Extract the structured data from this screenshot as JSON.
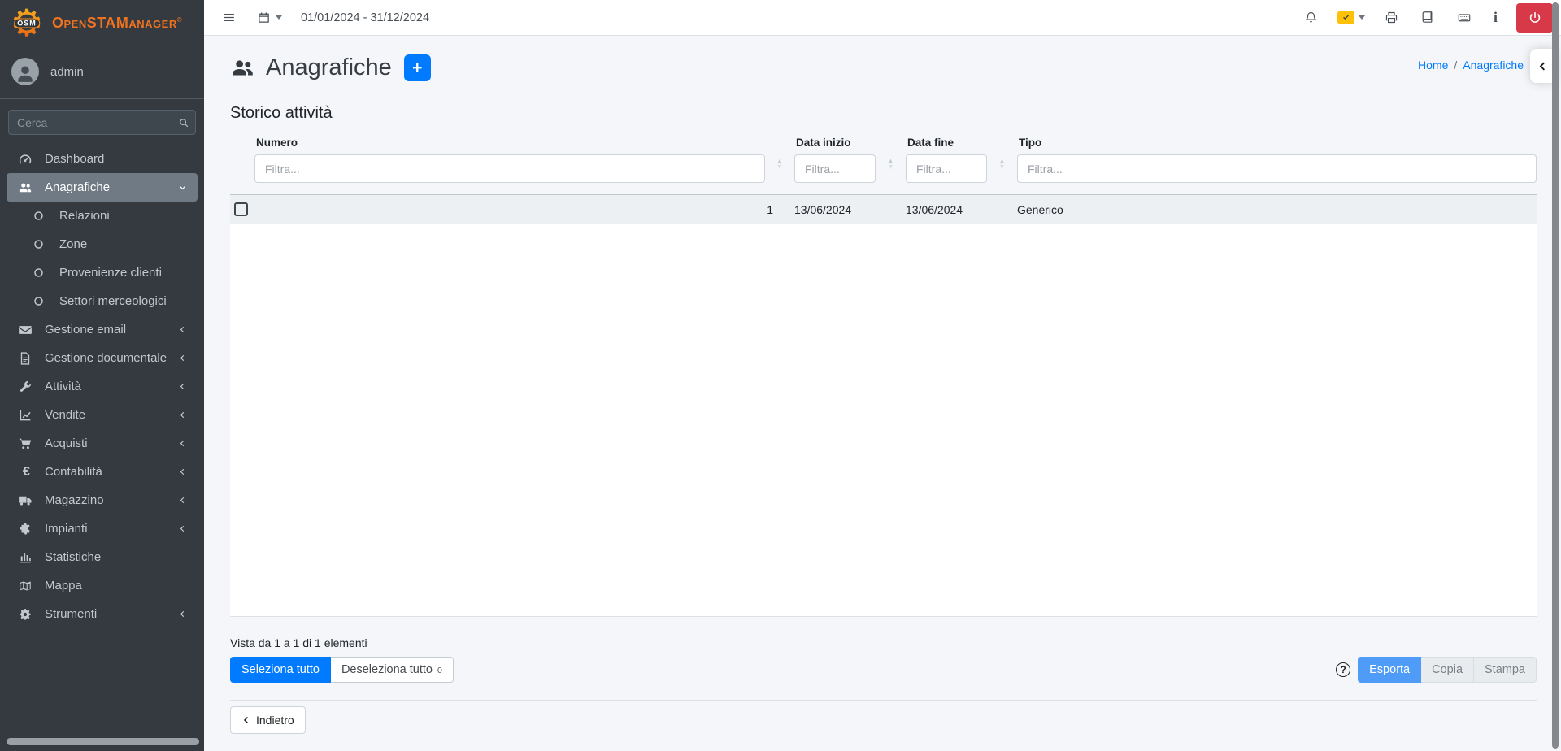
{
  "branding": {
    "logo_text": "OSM",
    "app_name": "OpenSTAManager",
    "registered": "®"
  },
  "user": {
    "name": "admin"
  },
  "topbar": {
    "date_range": "01/01/2024 - 31/12/2024",
    "icons": [
      "hamburger-icon",
      "calendar-icon",
      "bell-icon",
      "status-check-badge",
      "printer-icon",
      "book-icon",
      "keyboard-icon",
      "info-icon",
      "power-icon"
    ]
  },
  "sidebar": {
    "search_placeholder": "Cerca",
    "items": [
      {
        "label": "Dashboard",
        "icon": "tachometer-icon"
      },
      {
        "label": "Anagrafiche",
        "icon": "users-icon",
        "active": true,
        "expanded": true
      },
      {
        "label": "Relazioni",
        "icon": "circle-o-icon",
        "child": true
      },
      {
        "label": "Zone",
        "icon": "circle-o-icon",
        "child": true
      },
      {
        "label": "Provenienze clienti",
        "icon": "circle-o-icon",
        "child": true
      },
      {
        "label": "Settori merceologici",
        "icon": "circle-o-icon",
        "child": true
      },
      {
        "label": "Gestione email",
        "icon": "envelope-icon",
        "has_children": true
      },
      {
        "label": "Gestione documentale",
        "icon": "file-icon",
        "has_children": true
      },
      {
        "label": "Attività",
        "icon": "wrench-icon",
        "has_children": true
      },
      {
        "label": "Vendite",
        "icon": "chart-line-icon",
        "has_children": true
      },
      {
        "label": "Acquisti",
        "icon": "cart-icon",
        "has_children": true
      },
      {
        "label": "Contabilità",
        "icon": "euro-icon",
        "has_children": true
      },
      {
        "label": "Magazzino",
        "icon": "truck-icon",
        "has_children": true
      },
      {
        "label": "Impianti",
        "icon": "puzzle-icon",
        "has_children": true
      },
      {
        "label": "Statistiche",
        "icon": "chart-bar-icon"
      },
      {
        "label": "Mappa",
        "icon": "map-icon"
      },
      {
        "label": "Strumenti",
        "icon": "gear-icon",
        "has_children": true
      }
    ]
  },
  "page": {
    "title": "Anagrafiche",
    "add_label": "+",
    "breadcrumb_home": "Home",
    "breadcrumb_sep": "/",
    "breadcrumb_current": "Anagrafiche",
    "section_title": "Storico attività"
  },
  "table": {
    "columns": [
      "Numero",
      "Data inizio",
      "Data fine",
      "Tipo"
    ],
    "filter_placeholder": "Filtra...",
    "rows": [
      {
        "numero": "1",
        "data_inizio": "13/06/2024",
        "data_fine": "13/06/2024",
        "tipo": "Generico"
      }
    ]
  },
  "footer": {
    "info": "Vista da 1 a 1 di 1 elementi",
    "select_all": "Seleziona tutto",
    "deselect_all": "Deseleziona tutto",
    "deselect_count": "0",
    "help_glyph": "?",
    "export": "Esporta",
    "copy": "Copia",
    "print": "Stampa",
    "back": "Indietro"
  },
  "colors": {
    "primary": "#007bff",
    "export_blue": "#4f9cf8",
    "danger": "#d73948",
    "warning": "#ffc107",
    "sidebar_bg": "#343a40",
    "sidebar_active_bg": "#6f7a85",
    "logo_orange": "#ee7220",
    "content_bg": "#f4f6f9"
  }
}
